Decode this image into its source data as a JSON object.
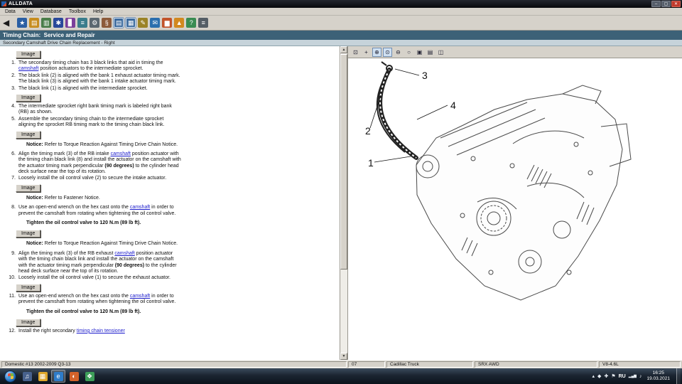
{
  "window": {
    "title": "ALLDATA",
    "menu": [
      "Data",
      "View",
      "Database",
      "Toolbox",
      "Help"
    ],
    "controls": {
      "minimize": "–",
      "maximize": "▢",
      "close": "✕"
    }
  },
  "toolbar": {
    "back_glyph": "◀",
    "icons": [
      {
        "name": "bookmark-icon",
        "glyph": "★",
        "bg": "#2b5fa3"
      },
      {
        "name": "open-folder-icon",
        "glyph": "▤",
        "bg": "#c78d1e"
      },
      {
        "name": "document-icon",
        "glyph": "▥",
        "bg": "#4a7d49"
      },
      {
        "name": "new-vehicle-icon",
        "glyph": "✱",
        "bg": "#29489b"
      },
      {
        "name": "graph-icon",
        "glyph": "▊",
        "bg": "#7b3f9b"
      },
      {
        "name": "wiring-diagram-icon",
        "glyph": "≡",
        "bg": "#3a7d8c"
      },
      {
        "name": "component-icon",
        "glyph": "⚙",
        "bg": "#5b6770"
      },
      {
        "name": "specs-icon",
        "glyph": "§",
        "bg": "#8c5a3a"
      },
      {
        "name": "view-article-icon",
        "glyph": "▤",
        "bg": "#3d6b9e",
        "pressed": true
      },
      {
        "name": "view-image-icon",
        "glyph": "▦",
        "bg": "#3d6b9e",
        "pressed": true
      },
      {
        "name": "notes-icon",
        "glyph": "✎",
        "bg": "#9b8326"
      },
      {
        "name": "mail-icon",
        "glyph": "✉",
        "bg": "#2b6fae"
      },
      {
        "name": "highlight-icon",
        "glyph": "▆",
        "bg": "#c2542a"
      },
      {
        "name": "upload-icon",
        "glyph": "▲",
        "bg": "#d2891f"
      },
      {
        "name": "help-icon",
        "glyph": "?",
        "bg": "#3a8c52"
      },
      {
        "name": "print-icon",
        "glyph": "≡",
        "bg": "#555e66"
      }
    ]
  },
  "header": {
    "title": "Timing Chain:  Service and Repair",
    "subtitle": "Secondary Camshaft Drive Chain Replacement - Right"
  },
  "article": {
    "image_button_label": "Image",
    "blocks": [
      {
        "type": "image"
      },
      {
        "type": "steps",
        "items": [
          {
            "num": "1.",
            "segs": [
              "The secondary timing chain has 3 black links that aid in timing the ",
              {
                "link": "camshaft",
                "name": "camshaft-link"
              },
              " position actuators to the intermediate sprocket."
            ]
          },
          {
            "num": "2.",
            "segs": [
              "The black link (2) is aligned with the bank 1 exhaust actuator timing mark. The black link (3) is aligned with the bank 1 intake actuator timing mark."
            ]
          },
          {
            "num": "3.",
            "segs": [
              "The black link (1) is aligned with the intermediate sprocket."
            ]
          }
        ]
      },
      {
        "type": "image"
      },
      {
        "type": "steps",
        "items": [
          {
            "num": "4.",
            "segs": [
              "The intermediate sprocket right bank timing mark is labeled right bank (RB) as shown."
            ]
          },
          {
            "num": "5.",
            "segs": [
              "Assemble the secondary timing chain to the intermediate sprocket aligning the sprocket RB timing mark to the timing chain black link."
            ]
          }
        ]
      },
      {
        "type": "image"
      },
      {
        "type": "notice",
        "bold": "Notice:",
        "text": " Refer to Torque Reaction Against Timing Drive Chain Notice."
      },
      {
        "type": "steps",
        "items": [
          {
            "num": "6.",
            "segs": [
              "Align the timing mark (3) of the RB intake ",
              {
                "link": "camshaft",
                "name": "camshaft-link"
              },
              " position actuator with the timing chain black link (8) and install the actuator on the camshaft with the actuator timing mark perpendicular ",
              {
                "b": "(90 degrees)"
              },
              " to the cylinder head deck surface near the top of its rotation."
            ]
          },
          {
            "num": "7.",
            "segs": [
              "Loosely install the oil control valve (2) to secure the intake actuator."
            ]
          }
        ]
      },
      {
        "type": "image"
      },
      {
        "type": "notice",
        "bold": "Notice:",
        "text": " Refer to Fastener Notice."
      },
      {
        "type": "steps",
        "items": [
          {
            "num": "8.",
            "segs": [
              "Use an open-end wrench on the hex cast onto the ",
              {
                "link": "camshaft",
                "name": "camshaft-link"
              },
              " in order to prevent the camshaft from rotating when tightening the oil control valve."
            ]
          }
        ]
      },
      {
        "type": "torque",
        "text": "Tighten the oil control valve to 120 N.m (89 lb ft)."
      },
      {
        "type": "image"
      },
      {
        "type": "notice",
        "bold": "Notice:",
        "text": " Refer to Torque Reaction Against Timing Drive Chain Notice."
      },
      {
        "type": "steps",
        "items": [
          {
            "num": "9.",
            "segs": [
              "Align the timing mark (3) of the RB exhaust ",
              {
                "link": "camshaft",
                "name": "camshaft-link"
              },
              " position actuator with the timing chain black link and install the actuator on the camshaft with the actuator timing mark perpendicular ",
              {
                "b": "(90 degrees)"
              },
              " to the cylinder head deck surface near the top of its rotation."
            ]
          },
          {
            "num": "10.",
            "segs": [
              "Loosely install the oil control valve (1) to secure the exhaust actuator."
            ]
          }
        ]
      },
      {
        "type": "image"
      },
      {
        "type": "steps",
        "items": [
          {
            "num": "11.",
            "segs": [
              "Use an open-end wrench on the hex cast onto the ",
              {
                "link": "camshaft",
                "name": "camshaft-link"
              },
              " in order to prevent the camshaft from rotating when tightening the oil control valve."
            ]
          }
        ]
      },
      {
        "type": "torque",
        "text": "Tighten the oil control valve to 120 N.m (89 lb ft)."
      },
      {
        "type": "image"
      },
      {
        "type": "steps",
        "items": [
          {
            "num": "12.",
            "segs": [
              "Install the right secondary ",
              {
                "link": "timing chain tensioner",
                "name": "timing-chain-tensioner-link"
              }
            ]
          }
        ]
      }
    ]
  },
  "diagram": {
    "callouts": [
      "1",
      "2",
      "3",
      "4"
    ],
    "toolbar": [
      {
        "name": "zoom-region-icon",
        "glyph": "⊡"
      },
      {
        "name": "pan-icon",
        "glyph": "+"
      },
      {
        "name": "zoom-in-icon",
        "glyph": "⊕",
        "pressed": true
      },
      {
        "name": "zoom-dynamic-icon",
        "glyph": "⊙",
        "pressed": true
      },
      {
        "name": "zoom-out-icon",
        "glyph": "⊖"
      },
      {
        "name": "magnifier-icon",
        "glyph": "○"
      },
      {
        "name": "fit-window-icon",
        "glyph": "▣"
      },
      {
        "name": "image-print-icon",
        "glyph": "▤"
      },
      {
        "name": "image-info-icon",
        "glyph": "◫"
      }
    ]
  },
  "statusbar": {
    "book": "Domestic #13 2002-2009 Q3-13",
    "code": "07",
    "make": "Cadillac Truck",
    "model": "SRX AWD",
    "engine": "V8-4.6L"
  },
  "taskbar": {
    "apps": [
      {
        "name": "media-app-icon",
        "glyph": "♫",
        "bg": "#47618c"
      },
      {
        "name": "explorer-folder-icon",
        "glyph": "▦",
        "bg": "#dda62a"
      },
      {
        "name": "internet-explorer-icon",
        "glyph": "e",
        "bg": "#2e7cc9",
        "active": true
      },
      {
        "name": "firefox-browser-icon",
        "glyph": "◐",
        "bg": "#d2622a"
      },
      {
        "name": "messenger-icon",
        "glyph": "❖",
        "bg": "#3d9e59"
      }
    ],
    "tray": {
      "hidden_icons_glyph": "▴",
      "icons": [
        {
          "name": "tray-app-1-icon",
          "glyph": "◆"
        },
        {
          "name": "tray-app-2-icon",
          "glyph": "✚"
        },
        {
          "name": "action-center-icon",
          "glyph": "⚑"
        }
      ],
      "language": "RU",
      "network_glyph": "▂▄▆",
      "volume_glyph": "♪",
      "clock": {
        "time": "16:25",
        "date": "19.03.2021"
      }
    }
  }
}
